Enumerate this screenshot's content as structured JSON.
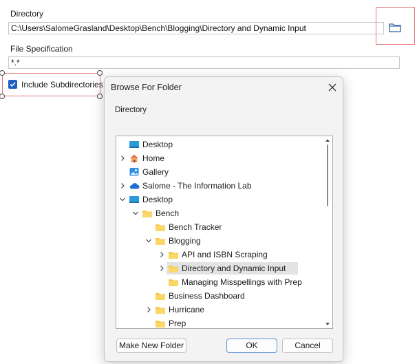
{
  "form": {
    "directory_label": "Directory",
    "directory_value": "C:\\Users\\SalomeGrasland\\Desktop\\Bench\\Blogging\\Directory and Dynamic Input",
    "file_spec_label": "File Specification",
    "file_spec_value": "*.*",
    "include_subdirs_label": "Include Subdirectories",
    "include_subdirs_checked": true,
    "browse_icon": "folder-icon"
  },
  "dialog": {
    "title": "Browse For Folder",
    "label": "Directory",
    "tree": [
      {
        "label": "Desktop",
        "icon": "desktop-icon",
        "level": 0,
        "arrow": "none"
      },
      {
        "label": "Home",
        "icon": "home-icon",
        "level": 0,
        "arrow": "right"
      },
      {
        "label": "Gallery",
        "icon": "gallery-icon",
        "level": 0,
        "arrow": "none"
      },
      {
        "label": "Salome - The Information Lab",
        "icon": "cloud-icon",
        "level": 0,
        "arrow": "right"
      },
      {
        "label": "Desktop",
        "icon": "desktop-icon",
        "level": 0,
        "arrow": "down"
      },
      {
        "label": "Bench",
        "icon": "folder-icon",
        "level": 1,
        "arrow": "down"
      },
      {
        "label": "Bench Tracker",
        "icon": "folder-icon",
        "level": 2,
        "arrow": "none"
      },
      {
        "label": "Blogging",
        "icon": "folder-icon",
        "level": 2,
        "arrow": "down"
      },
      {
        "label": "API and ISBN Scraping",
        "icon": "folder-icon",
        "level": 3,
        "arrow": "right"
      },
      {
        "label": "Directory and Dynamic Input",
        "icon": "folder-icon",
        "level": 3,
        "arrow": "right",
        "selected": true
      },
      {
        "label": "Managing Misspellings with Prep",
        "icon": "folder-icon",
        "level": 3,
        "arrow": "none"
      },
      {
        "label": "Business Dashboard",
        "icon": "folder-icon",
        "level": 2,
        "arrow": "none"
      },
      {
        "label": "Hurricane",
        "icon": "folder-icon",
        "level": 2,
        "arrow": "right"
      },
      {
        "label": "Prep",
        "icon": "folder-icon",
        "level": 2,
        "arrow": "none"
      }
    ],
    "buttons": {
      "make_new_folder": "Make New Folder",
      "ok": "OK",
      "cancel": "Cancel"
    }
  },
  "colors": {
    "accent": "#1f5fbf",
    "folder": "#f5c84c",
    "highlight_border": "#e07a7a"
  }
}
